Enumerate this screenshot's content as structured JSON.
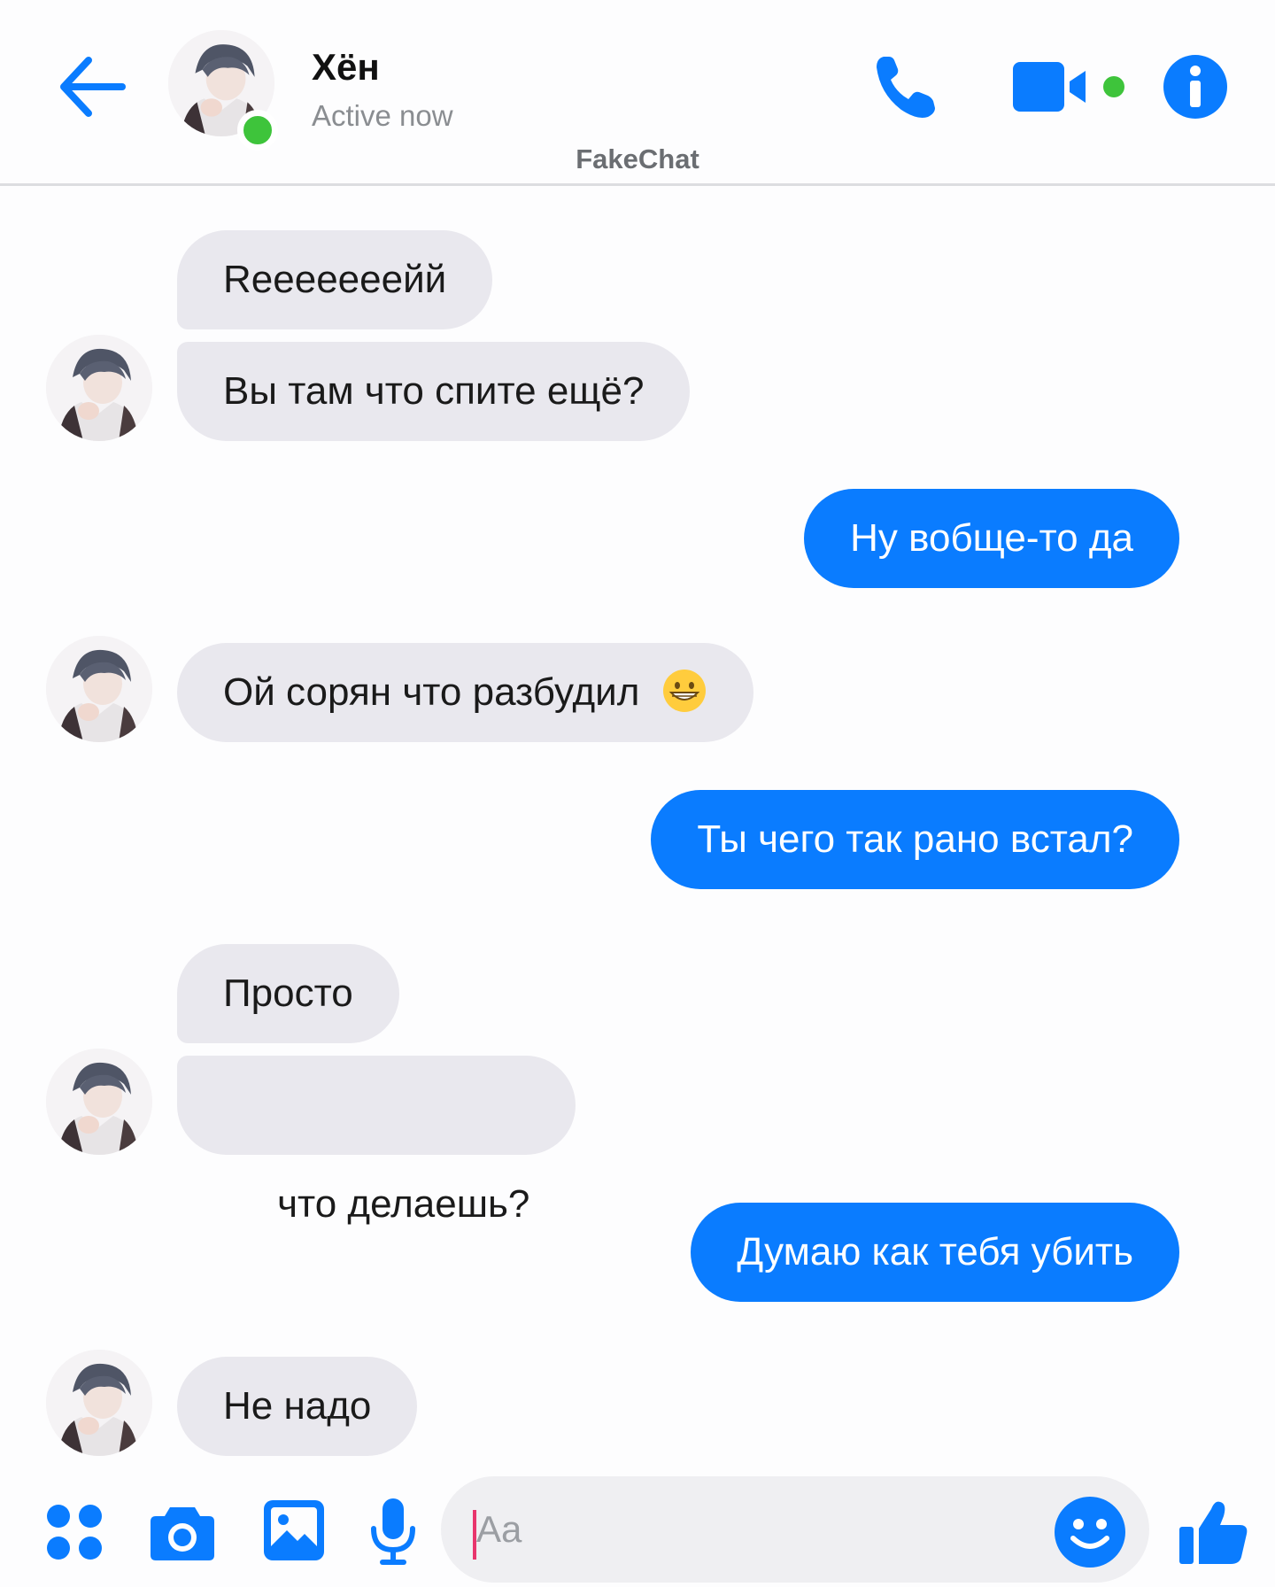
{
  "header": {
    "contact_name": "Хён",
    "status": "Active now",
    "brand": "FakeChat"
  },
  "messages": [
    {
      "side": "in",
      "text": "Reeeeeeeйй"
    },
    {
      "side": "in",
      "text": "Вы там что спите ещё?"
    },
    {
      "side": "out",
      "text": "Ну вобще-то да"
    },
    {
      "side": "in",
      "text": "Ой сорян что разбудил",
      "emoji": "grinning-face-icon"
    },
    {
      "side": "out",
      "text": "Ты чего так рано встал?"
    },
    {
      "side": "in",
      "text": "Просто"
    },
    {
      "side": "in",
      "text": " что делаешь?"
    },
    {
      "side": "out",
      "text": "Думаю как тебя убить"
    },
    {
      "side": "in",
      "text": "Не надо"
    }
  ],
  "composer": {
    "placeholder": "Aa"
  },
  "colors": {
    "accent": "#0a7cff",
    "incoming_bubble": "#e9e8ee",
    "online": "#3ec43b"
  },
  "icons": [
    "back-arrow-icon",
    "phone-icon",
    "video-camera-icon",
    "info-icon",
    "apps-grid-icon",
    "camera-icon",
    "image-icon",
    "microphone-icon",
    "smiley-icon",
    "thumbs-up-icon"
  ]
}
